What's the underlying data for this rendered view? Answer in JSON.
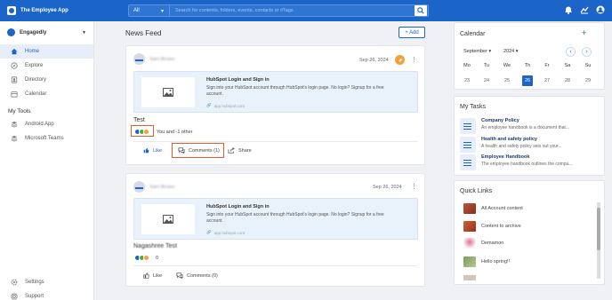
{
  "app": {
    "title": "The Employee App"
  },
  "search": {
    "scope": "All",
    "placeholder": "Search for contents, folders, events, contacts or #Tags"
  },
  "org": {
    "name": "Engagedly"
  },
  "nav": {
    "items": [
      {
        "label": "Home",
        "active": true
      },
      {
        "label": "Explore"
      },
      {
        "label": "Directory"
      },
      {
        "label": "Calendar"
      }
    ]
  },
  "tools": {
    "title": "My Tools",
    "items": [
      {
        "label": "Android App"
      },
      {
        "label": "Microsoft Teams"
      }
    ]
  },
  "bottom_nav": {
    "items": [
      {
        "label": "Settings"
      },
      {
        "label": "Support"
      }
    ]
  },
  "feed": {
    "title": "News Feed",
    "add_label": "+ Add"
  },
  "posts": [
    {
      "author": "Sam Brown",
      "date": "Sep 26, 2024",
      "link": {
        "title": "HubSpot Login and Sign in",
        "desc": "Sign into your HubSpot account through HubSpot's login page. No login? Signup for a free account.",
        "url": "app.hubspot.com"
      },
      "title": "Test",
      "reactions_text": "You and -1 other",
      "like_label": "Like",
      "comments_label": "Comments (1)",
      "share_label": "Share"
    },
    {
      "author": "Sam Brown",
      "date": "Sep 26, 2024",
      "link": {
        "title": "HubSpot Login and Sign in",
        "desc": "Sign into your HubSpot account through HubSpot's login page. No login? Signup for a free account.",
        "url": "app.hubspot.com"
      },
      "title": "Nagashree Test",
      "reactions_text": "0",
      "like_label": "Like",
      "comments_label": "Comments (0)"
    }
  ],
  "calendar": {
    "title": "Calendar",
    "month": "September",
    "year": "2024",
    "weekdays": [
      "Mo",
      "Tu",
      "We",
      "Th",
      "Fr",
      "Sa",
      "Su"
    ],
    "days": [
      "23",
      "24",
      "25",
      "26",
      "27",
      "28",
      "29"
    ],
    "today_index": 3
  },
  "tasks": {
    "title": "My Tasks",
    "items": [
      {
        "title": "Company Policy",
        "desc": "An employee handbook is a document that..."
      },
      {
        "title": "Health and safety policy",
        "desc": "A health and safety policy sets out your..."
      },
      {
        "title": "Employee Handbook",
        "desc": "The employee handbook outlines the compu..."
      }
    ]
  },
  "quick_links": {
    "title": "Quick Links",
    "items": [
      {
        "label": "All Account content"
      },
      {
        "label": "Content to archive"
      },
      {
        "label": "Demamon"
      },
      {
        "label": "Hello spring!!"
      }
    ]
  },
  "colors": {
    "brand": "#1b64c8",
    "highlight": "#e85a2b",
    "badge": "#f2a03a"
  }
}
